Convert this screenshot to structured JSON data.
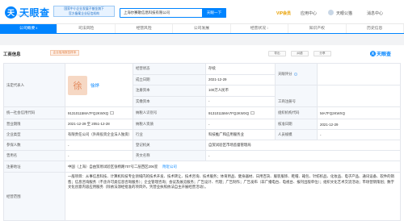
{
  "header": {
    "logo_glyph": "天",
    "logo_text": "天眼查",
    "logo_sub": "TianYanCha.com",
    "ad_line1": "国家中小企业发展子基金旗下",
    "ad_line2": "官方备案企业征信机构",
    "search_value": "上海尔赛歌信息科技有限公司",
    "search_button": "天眼一下",
    "nav": [
      "VIP会员",
      "应用中心",
      "天眼公猫",
      "消息中心"
    ]
  },
  "tabs": [
    {
      "label": "公司概要",
      "count": "4",
      "active": true
    },
    {
      "label": "司法风险",
      "count": "",
      "active": false
    },
    {
      "label": "经营风险",
      "count": "",
      "active": false
    },
    {
      "label": "公司发展",
      "count": "",
      "active": false
    },
    {
      "label": "经营状况",
      "count": "1",
      "active": false
    },
    {
      "label": "知识产权",
      "count": "",
      "active": false
    },
    {
      "label": "历史信息",
      "count": "",
      "active": false
    }
  ],
  "section": {
    "title": "工商信息",
    "badge": "企业信用报告样本",
    "actions": [
      "导出",
      "纠错",
      "分享"
    ],
    "watermark": "天眼查",
    "watermark_glyph": "天"
  },
  "info": {
    "legal_rep_label": "法定代表人",
    "legal_rep_avatar": "徐",
    "legal_rep_name": "徐烨",
    "status_label": "经营状态",
    "status_value": "存续",
    "tianyan_score_label": "天眼评分",
    "est_date_label": "成立日期",
    "est_date_value": "2021-12-29",
    "reg_cap_label": "注册资本",
    "reg_cap_value": "100万人民币",
    "paid_cap_label": "实缴资本",
    "paid_cap_value": "-",
    "staff_label": "工商注册号",
    "staff_value": "",
    "credit_code_label": "统一社会信用代码",
    "credit_code_value": "91310115MA7FQ2KWXQ",
    "taxpayer_id_label": "纳税人识别号",
    "taxpayer_id_value": "91310115MA7FQ2KWXQ",
    "org_code_label": "组织机构代码",
    "org_code_value": "MA7FQ2KWXQ",
    "biz_term_label": "营业期限",
    "biz_term_value": "2021-12-29 至 2051-12-28",
    "taxpayer_q_label": "纳税人资质",
    "taxpayer_q_value": "-",
    "approve_date_label": "核准日期",
    "approve_date_value": "2021-12-29",
    "company_type_label": "企业类型",
    "company_type_value": "有限责任公司（外商投资企业法人独资）",
    "industry_label": "行业",
    "industry_value": "科技推广和应用服务业",
    "insured_label": "人员规模",
    "insured_value": "-",
    "insured_num_label": "参保人数",
    "insured_num_value": "-",
    "authority_label": "登记机关",
    "authority_value": "自贸试验区市场监督管理局",
    "former_name_label": "曾用名",
    "former_name_value": "-",
    "en_name_label": "英文名称",
    "en_name_value": "-",
    "address_label": "注册地址",
    "address_value": "中国（上海）自由贸易试验区张杨路707号二层西区206室",
    "address_link": "附近公司",
    "scope_label": "经营范围",
    "scope_value": "一般项目：从事信息科技、计算机科技专业领域内的技术开发、技术转让、技术咨询、技术服务；体育用品、健身器材、日用百货、服装服饰、鞋帽、箱包、针纺织品、化妆品、电子产品、通讯设备、软件的销售；信息咨询服务（不含许可类信息咨询服务）；企业管理咨询；会议及展览服务；广告设计、代理；广告制作；广告发布（非广播电台、电视台、报刊出版单位）；组织文化艺术交流活动；市场营销策划；数字文化创意内容应用服务（除依法须经批准的项目外，凭营业执照依法自主开展经营活动）。"
  }
}
